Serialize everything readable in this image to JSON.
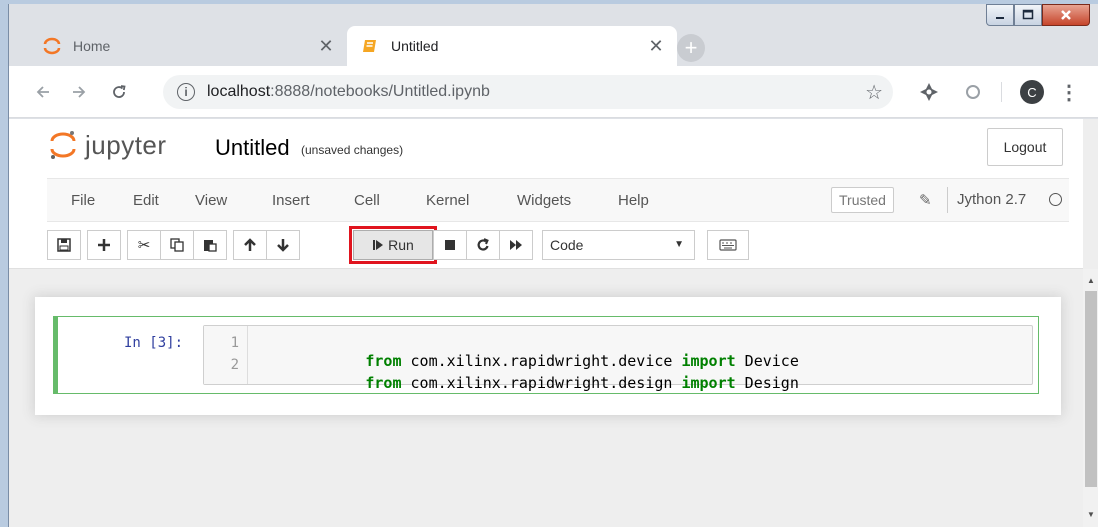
{
  "browser": {
    "tabs": [
      {
        "title": "Home",
        "active": false,
        "icon": "jupyter-home-icon"
      },
      {
        "title": "Untitled",
        "active": true,
        "icon": "notebook-icon"
      }
    ],
    "close_glyph": "✕",
    "new_tab_glyph": "+",
    "url_host": "localhost",
    "url_path": ":8888/notebooks/Untitled.ipynb",
    "profile_initial": "C"
  },
  "jupyter": {
    "wordmark": "jupyter",
    "notebook_name": "Untitled",
    "save_status": "(unsaved changes)",
    "logout_label": "Logout",
    "menu": [
      "File",
      "Edit",
      "View",
      "Insert",
      "Cell",
      "Kernel",
      "Widgets",
      "Help"
    ],
    "trusted_label": "Trusted",
    "kernel_name": "Jython 2.7",
    "run_label": "Run",
    "cell_type": "Code"
  },
  "cell": {
    "prompt": "In [3]:",
    "lines": [
      {
        "number": "1",
        "tokens": [
          [
            "kw",
            "from"
          ],
          [
            "",
            "com.xilinx.rapidwright.device "
          ],
          [
            "kw",
            "import"
          ],
          [
            "",
            " Device"
          ]
        ]
      },
      {
        "number": "2",
        "tokens": [
          [
            "kw",
            "from"
          ],
          [
            "",
            "com.xilinx.rapidwright.design "
          ],
          [
            "kw",
            "import"
          ],
          [
            "",
            " Design"
          ]
        ]
      }
    ]
  },
  "colors": {
    "accent_cell": "#66bb6a",
    "highlight": "#e0141e",
    "keyword": "#008000",
    "prompt": "#303f9f"
  }
}
